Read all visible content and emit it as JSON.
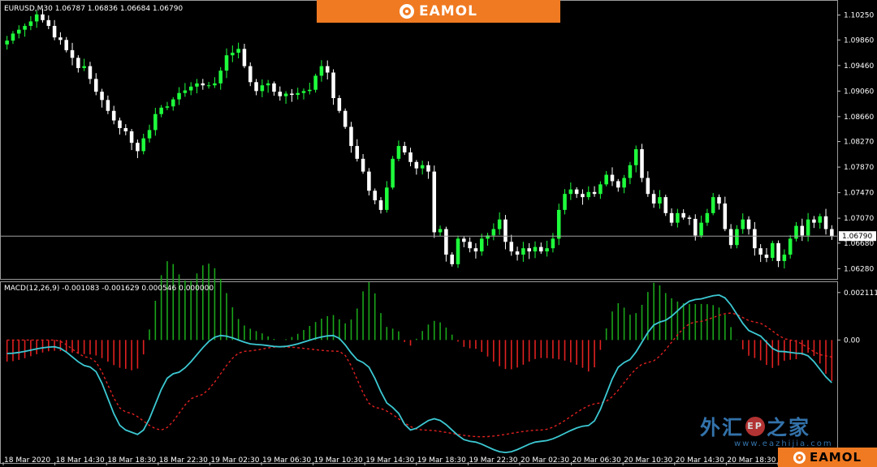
{
  "header": {
    "symbol_info": "EURUSD,M30  1.06787 1.06836 1.06684 1.06790",
    "indicator_info": "MACD(12,26,9) -0.001083 -0.001629 0.000546 0.000000",
    "brand_top": "EAMOL",
    "brand_bottom": "EAMOL",
    "watermark_left": "外汇",
    "watermark_badge": "EP",
    "watermark_right": "之家",
    "watermark_url": "www.eazhijia.com"
  },
  "colors": {
    "bull": "#1eff3c",
    "bear": "#ffffff",
    "hist_pos": "#1aa51a",
    "hist_neg": "#e02020",
    "macd_line": "#3cc8d2",
    "signal_line": "#e02020",
    "brand": "#f07a22"
  },
  "chart_data": [
    {
      "type": "candlestick",
      "title": "EURUSD,M30  1.06787 1.06836 1.06684 1.06790",
      "ylim": [
        1.0612,
        1.1046
      ],
      "y_ticks": [
        "1.10250",
        "1.09860",
        "1.09460",
        "1.09060",
        "1.08660",
        "1.08270",
        "1.07870",
        "1.07470",
        "1.07070",
        "1.06680",
        "1.06280"
      ],
      "current_price": "1.06790",
      "closes": [
        1.0985,
        1.0996,
        1.1002,
        1.1008,
        1.1015,
        1.1026,
        1.1017,
        1.1008,
        1.099,
        1.0986,
        1.097,
        1.0958,
        1.0942,
        1.0945,
        1.0925,
        1.0905,
        1.0892,
        1.0875,
        1.086,
        1.0848,
        1.0843,
        1.0825,
        1.0812,
        1.0832,
        1.0845,
        1.087,
        1.088,
        1.0882,
        1.0893,
        1.0903,
        1.0907,
        1.0913,
        1.0918,
        1.0915,
        1.0915,
        1.0918,
        1.0938,
        1.0962,
        1.0966,
        1.0972,
        1.0945,
        1.092,
        1.0906,
        1.0915,
        1.0918,
        1.0905,
        1.0898,
        1.0902,
        1.09,
        1.0903,
        1.0906,
        1.0908,
        1.093,
        1.0945,
        1.0935,
        1.0895,
        1.0875,
        1.085,
        1.082,
        1.08,
        1.078,
        1.075,
        1.0735,
        1.072,
        1.0755,
        1.08,
        1.082,
        1.081,
        1.0795,
        1.0785,
        1.079,
        1.078,
        1.0685,
        1.069,
        1.065,
        1.0635,
        1.0675,
        1.067,
        1.066,
        1.0655,
        1.0675,
        1.068,
        1.069,
        1.0705,
        1.067,
        1.0655,
        1.065,
        1.066,
        1.0655,
        1.0662,
        1.0655,
        1.066,
        1.0675,
        1.072,
        1.0745,
        1.0752,
        1.0745,
        1.074,
        1.0748,
        1.0745,
        1.076,
        1.0775,
        1.0765,
        1.0755,
        1.077,
        1.079,
        1.0815,
        1.077,
        1.0745,
        1.073,
        1.074,
        1.0715,
        1.07,
        1.0715,
        1.0708,
        1.0706,
        1.068,
        1.07,
        1.0715,
        1.074,
        1.073,
        1.069,
        1.0665,
        1.069,
        1.0705,
        1.069,
        1.066,
        1.065,
        1.0645,
        1.0668,
        1.064,
        1.065,
        1.0675,
        1.0695,
        1.068,
        1.0705,
        1.07,
        1.071,
        1.069,
        1.0679
      ],
      "x_ticks": [
        "18 Mar 2020",
        "18 Mar 14:30",
        "18 Mar 18:30",
        "18 Mar 22:30",
        "19 Mar 02:30",
        "19 Mar 06:30",
        "19 Mar 10:30",
        "19 Mar 14:30",
        "19 Mar 18:30",
        "19 Mar 22:30",
        "20 Mar 02:30",
        "20 Mar 06:30",
        "20 Mar 10:30",
        "20 Mar 14:30",
        "20 Mar 18:30",
        "20 Mar"
      ]
    },
    {
      "type": "bar",
      "title": "MACD(12,26,9) -0.001083 -0.001629 0.000546 0.000000",
      "ylim": [
        -0.0055,
        0.0025
      ],
      "y_ticks": [
        "0.002111",
        "0.00",
        "-0.005"
      ],
      "macd_anchors": [
        [
          0,
          -0.0006
        ],
        [
          8,
          -0.0003
        ],
        [
          14,
          -0.0012
        ],
        [
          20,
          -0.004
        ],
        [
          22,
          -0.0042
        ],
        [
          28,
          -0.0015
        ],
        [
          36,
          0.0002
        ],
        [
          42,
          -0.0002
        ],
        [
          46,
          -0.0003
        ],
        [
          55,
          0.0002
        ],
        [
          60,
          -0.001
        ],
        [
          65,
          -0.003
        ],
        [
          68,
          -0.004
        ],
        [
          72,
          -0.0035
        ],
        [
          78,
          -0.0045
        ],
        [
          84,
          -0.005
        ],
        [
          90,
          -0.0045
        ],
        [
          98,
          -0.0038
        ],
        [
          104,
          -0.001
        ],
        [
          110,
          0.0008
        ],
        [
          116,
          0.0018
        ],
        [
          120,
          0.002
        ],
        [
          126,
          0.0003
        ],
        [
          130,
          -0.0005
        ],
        [
          134,
          -0.0006
        ],
        [
          140,
          -0.002
        ],
        [
          144,
          -0.0015
        ],
        [
          150,
          -0.0012
        ],
        [
          153,
          -0.001
        ]
      ],
      "signal_anchors": [
        [
          0,
          0.0
        ],
        [
          8,
          0.0
        ],
        [
          14,
          -0.0008
        ],
        [
          20,
          -0.0032
        ],
        [
          26,
          -0.004
        ],
        [
          32,
          -0.0025
        ],
        [
          40,
          -0.0005
        ],
        [
          46,
          -0.0003
        ],
        [
          56,
          -0.0005
        ],
        [
          62,
          -0.003
        ],
        [
          70,
          -0.004
        ],
        [
          80,
          -0.0043
        ],
        [
          90,
          -0.004
        ],
        [
          100,
          -0.0028
        ],
        [
          108,
          -0.001
        ],
        [
          116,
          0.0008
        ],
        [
          122,
          0.0012
        ],
        [
          126,
          0.0008
        ],
        [
          132,
          0.0
        ],
        [
          138,
          -0.0007
        ],
        [
          144,
          -0.0015
        ],
        [
          150,
          -0.0016
        ],
        [
          153,
          -0.0015
        ]
      ]
    }
  ]
}
